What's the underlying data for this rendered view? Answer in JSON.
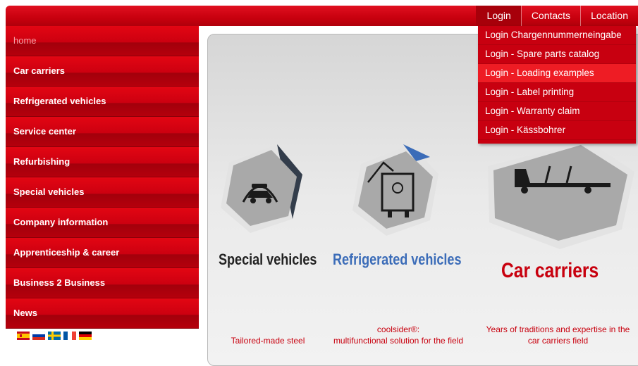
{
  "topnav": {
    "login": "Login",
    "contacts": "Contacts",
    "location": "Location"
  },
  "dropdown": [
    "Login Chargennummerneingabe",
    "Login - Spare parts catalog",
    "Login - Loading examples",
    "Login - Label printing",
    "Login - Warranty claim",
    "Login - Kässbohrer"
  ],
  "sidebar": [
    "home",
    "Car carriers",
    "Refrigerated vehicles",
    "Service center",
    "Refurbishing",
    "Special vehicles",
    "Company information",
    "Apprenticeship & career",
    "Business 2 Business",
    "News"
  ],
  "cards": {
    "special": {
      "title": "Special vehicles",
      "desc": "Tailored-made steel"
    },
    "refrigerated": {
      "title": "Refrigerated vehicles",
      "desc1": "coolsider®:",
      "desc2": "multifunctional solution for the field"
    },
    "car": {
      "title": "Car carriers",
      "desc1": "Years of traditions and expertise in the",
      "desc2": "car carriers field"
    }
  },
  "colors": {
    "brand_red": "#c8000e",
    "blue": "#3b6cb8",
    "hex_grey": "#a9a9a9"
  }
}
